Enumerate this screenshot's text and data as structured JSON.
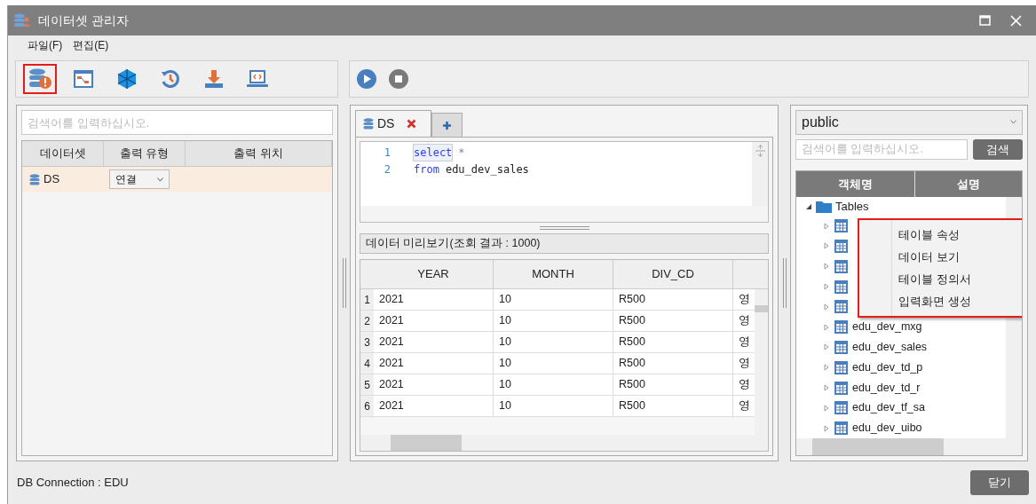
{
  "window": {
    "title": "데이터셋 관리자"
  },
  "menu": [
    "파일(F)",
    "편집(E)"
  ],
  "toolbar": [
    {
      "selected": true
    },
    {
      "selected": false
    },
    {
      "selected": false
    },
    {
      "selected": false
    },
    {
      "selected": false
    },
    {
      "selected": false
    }
  ],
  "dataset_panel": {
    "search": {
      "placeholder": "검색어를 입력하십시오."
    },
    "columns": [
      "데이터셋",
      "출력 유형",
      "출력 위치"
    ],
    "rows": [
      {
        "dataset": "DS",
        "output_type": "연결",
        "selected": true
      }
    ]
  },
  "editor": {
    "tabs": [
      {
        "label": "DS",
        "selected": true
      }
    ],
    "lines": [
      {
        "number": "1",
        "tokens": [
          {
            "kind": "keyword",
            "text": "select"
          },
          {
            "kind": "symbol",
            "text": "*"
          }
        ]
      },
      {
        "number": "2",
        "tokens": [
          {
            "kind": "keyword",
            "text": "from"
          },
          {
            "kind": "plain",
            "text": "edu_dev_sales"
          }
        ]
      }
    ]
  },
  "preview": {
    "title": "데이터 미리보기(조회 결과 : 1000)",
    "columns": [
      "YEAR",
      "MONTH",
      "DIV_CD"
    ],
    "rows": [
      {
        "number": "1",
        "cells": [
          "2021",
          "10",
          "R500",
          "영"
        ]
      },
      {
        "number": "2",
        "cells": [
          "2021",
          "10",
          "R500",
          "영"
        ]
      },
      {
        "number": "3",
        "cells": [
          "2021",
          "10",
          "R500",
          "영"
        ]
      },
      {
        "number": "4",
        "cells": [
          "2021",
          "10",
          "R500",
          "영"
        ]
      },
      {
        "number": "5",
        "cells": [
          "2021",
          "10",
          "R500",
          "영"
        ]
      },
      {
        "number": "6",
        "cells": [
          "2021",
          "10",
          "R500",
          "영"
        ]
      }
    ]
  },
  "object_panel": {
    "schema": "public",
    "search": {
      "placeholder": "검색어를 입력하십시오."
    },
    "search_button": "검색",
    "columns": [
      "객체명",
      "설명"
    ],
    "tree": [
      {
        "label": "Tables",
        "expanded": true,
        "children": [
          {
            "expanded": false
          },
          {
            "expanded": false
          },
          {
            "expanded": false
          },
          {
            "expanded": false
          },
          {
            "expanded": false
          },
          {
            "label": "edu_dev_mxg",
            "expanded": false
          },
          {
            "label": "edu_dev_sales",
            "expanded": false
          },
          {
            "label": "edu_dev_td_p",
            "expanded": false
          },
          {
            "label": "edu_dev_td_r",
            "expanded": false
          },
          {
            "label": "edu_dev_tf_sa",
            "expanded": false
          },
          {
            "label": "edu_dev_uibo",
            "expanded": false
          }
        ]
      }
    ]
  },
  "context_menu": {
    "items": [
      "테이블 속성",
      "데이터 보기",
      "테이블 정의서",
      "입력화면 생성"
    ]
  },
  "status_bar": {
    "connection": "DB Connection : EDU"
  },
  "close_button": "닫기"
}
